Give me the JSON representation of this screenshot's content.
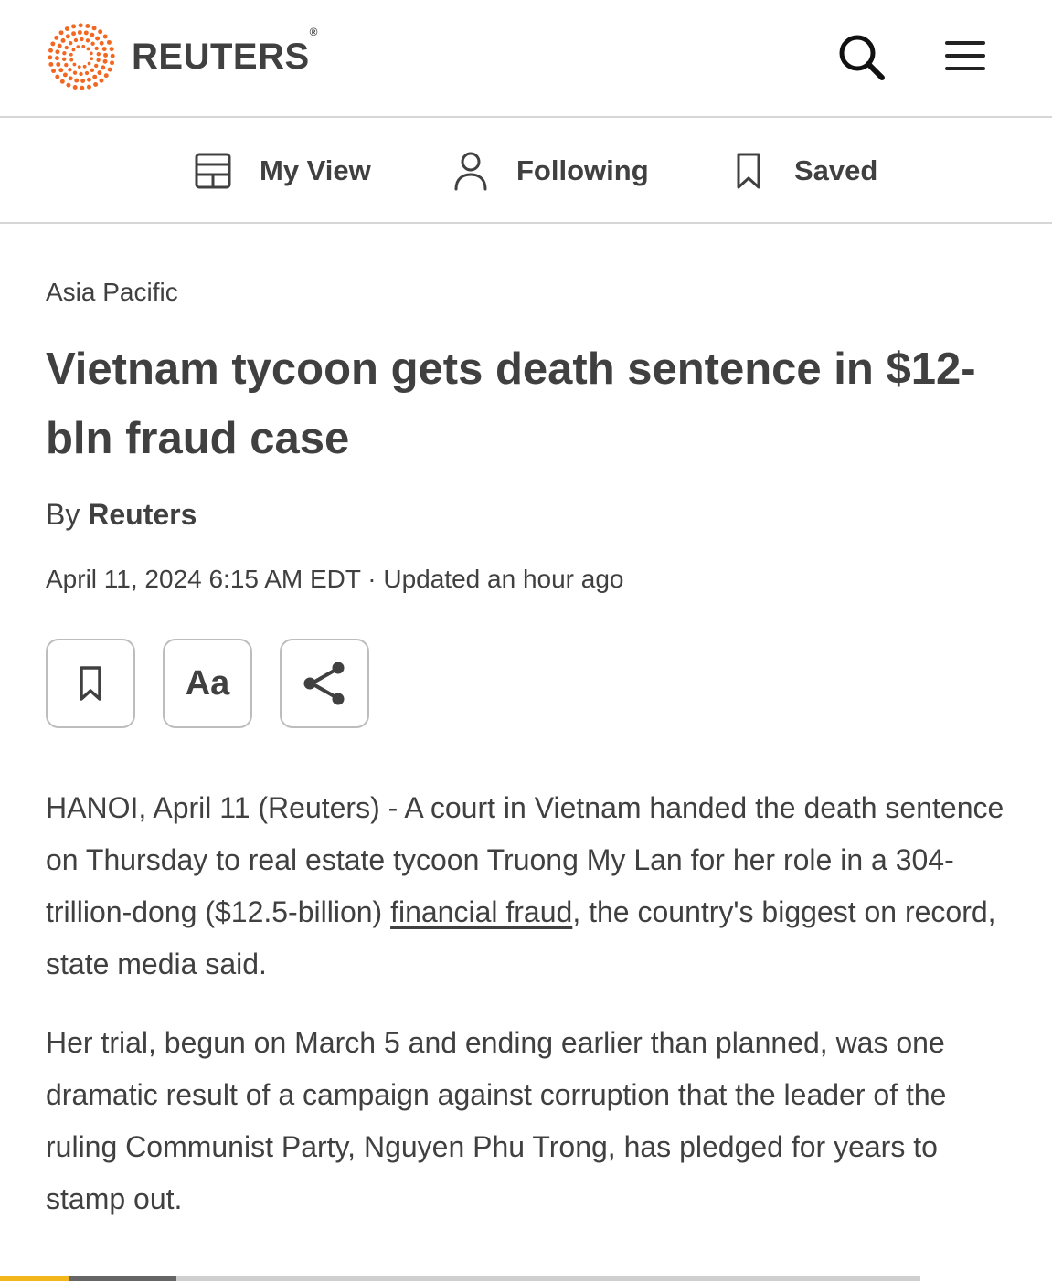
{
  "header": {
    "brand": "REUTERS",
    "brand_reg": "®",
    "brand_color": "#f26722",
    "icons": [
      "search-icon",
      "hamburger-menu-icon"
    ]
  },
  "subnav": {
    "items": [
      {
        "label": "My View",
        "icon": "layout-icon"
      },
      {
        "label": "Following",
        "icon": "person-icon"
      },
      {
        "label": "Saved",
        "icon": "bookmark-icon"
      }
    ]
  },
  "article": {
    "section": "Asia Pacific",
    "headline": "Vietnam tycoon gets death sentence in $12-bln fraud case",
    "byline_prefix": "By",
    "byline_author": "Reuters",
    "timestamp": "April 11, 2024 6:15 AM EDT · Updated an hour ago",
    "tools": {
      "bookmark_icon": "bookmark-icon",
      "font_label": "Aa",
      "share_icon": "share-icon"
    },
    "p1": {
      "before_link": "HANOI, April 11 (Reuters) - A court in Vietnam handed the death sentence on Thursday to real estate tycoon Truong My Lan for her role in a 304-trillion-dong ($12.5-billion) ",
      "link": "financial fraud",
      "after_link": ", the country's biggest on record, state media said."
    },
    "p2": "Her trial, begun on March 5 and ending earlier than planned, was one dramatic result of a campaign against corruption that the leader of the ruling Communist Party, Nguyen Phu Trong, has pledged for years to stamp out."
  },
  "reading_progress": {
    "colors": {
      "accent": "#f2b51a",
      "segment": "#666666",
      "track": "#cfcfcf"
    }
  }
}
